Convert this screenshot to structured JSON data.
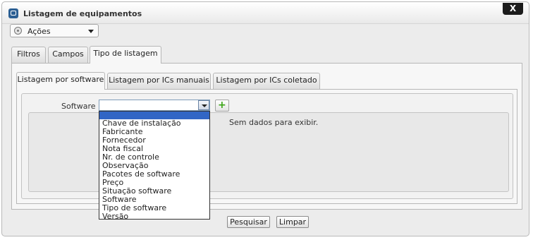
{
  "window": {
    "title": "Listagem de equipamentos",
    "close_label": "X"
  },
  "actions_menu": {
    "label": "Ações"
  },
  "main_tabs": [
    {
      "label": "Filtros"
    },
    {
      "label": "Campos"
    },
    {
      "label": "Tipo de listagem"
    }
  ],
  "sub_tabs": [
    {
      "label": "Listagem por software"
    },
    {
      "label": "Listagem por ICs manuais"
    },
    {
      "label": "Listagem por ICs coletado"
    }
  ],
  "software_field": {
    "label": "Software :",
    "value": ""
  },
  "grid": {
    "empty_message": "Sem dados para exibir."
  },
  "dropdown": {
    "options": [
      "",
      "Chave de instalação",
      "Fabricante",
      "Fornecedor",
      "Nota fiscal",
      "Nr. de controle",
      "Observação",
      "Pacotes de software",
      "Preço",
      "Situação software",
      "Software",
      "Tipo de software",
      "Versão"
    ]
  },
  "footer": {
    "search_label": "Pesquisar",
    "clear_label": "Limpar"
  },
  "colors": {
    "selected_option": "#3166c5",
    "add_icon": "#3aa415",
    "title_icon": "#2c5f93"
  }
}
